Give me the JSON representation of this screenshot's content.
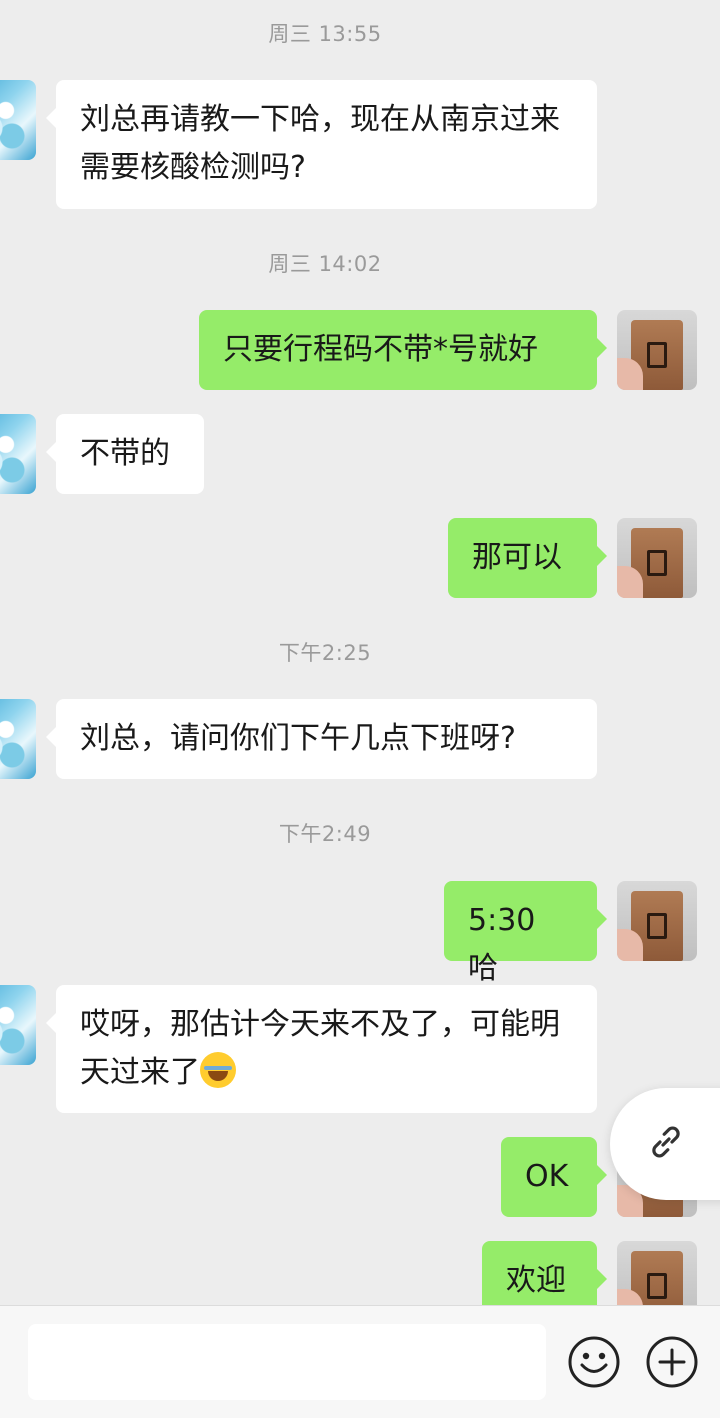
{
  "chat": {
    "timestamps": [
      "周三 13:55",
      "周三 14:02",
      "下午2:25",
      "下午2:49"
    ],
    "messages": [
      {
        "side": "received",
        "text": "刘总再请教一下哈，现在从南京过来需要核酸检测吗?"
      },
      {
        "side": "sent",
        "text": "只要行程码不带*号就好"
      },
      {
        "side": "received",
        "text": "不带的"
      },
      {
        "side": "sent",
        "text": "那可以"
      },
      {
        "side": "received",
        "text": "刘总，请问你们下午几点下班呀?"
      },
      {
        "side": "sent",
        "text": "5:30 哈"
      },
      {
        "side": "received",
        "text": "哎呀，那估计今天来不及了，可能明天过来了",
        "emoji": "tears-of-joy"
      },
      {
        "side": "sent",
        "text": "OK"
      },
      {
        "side": "sent",
        "text": "欢迎"
      }
    ]
  },
  "colors": {
    "background": "#ededed",
    "sent_bubble": "#95ec69",
    "received_bubble": "#ffffff",
    "timestamp": "#9a9a9a"
  },
  "icons": {
    "floating": "link-icon",
    "voice": "voice-icon",
    "emoji": "emoji-smiley-icon",
    "more": "plus-circle-icon"
  },
  "composer": {
    "value": ""
  }
}
